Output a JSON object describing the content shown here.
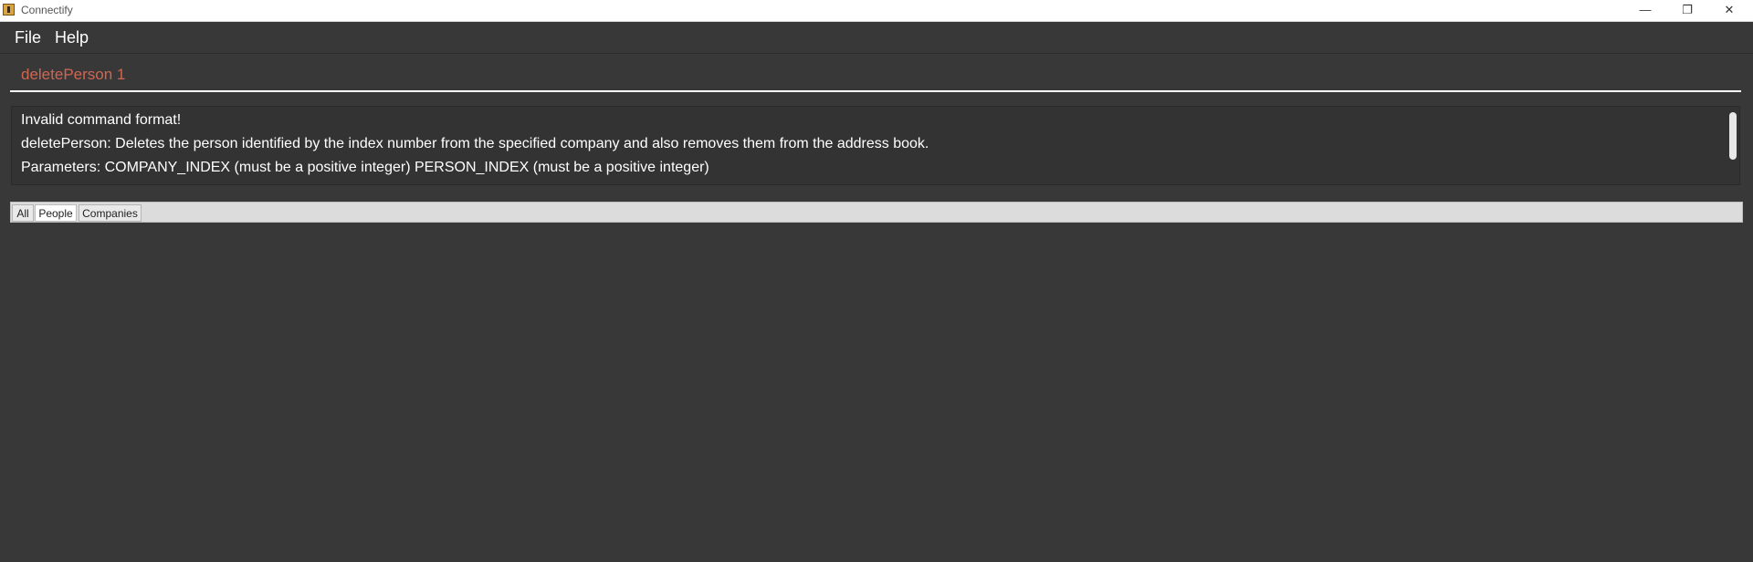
{
  "window": {
    "title": "Connectify",
    "minimize_glyph": "—",
    "restore_glyph": "❐",
    "close_glyph": "✕"
  },
  "menu": {
    "items": [
      "File",
      "Help"
    ]
  },
  "command": {
    "value": "deletePerson 1"
  },
  "result": {
    "lines": [
      "Invalid command format!",
      "deletePerson: Deletes the person identified by the index number from the specified company and also removes them from the address book.",
      "Parameters: COMPANY_INDEX (must be a positive integer) PERSON_INDEX (must be a positive integer)"
    ]
  },
  "tabs": {
    "items": [
      "All",
      "People",
      "Companies"
    ],
    "selected": "People"
  },
  "colors": {
    "background": "#383838",
    "command_error_text": "#d06651"
  }
}
